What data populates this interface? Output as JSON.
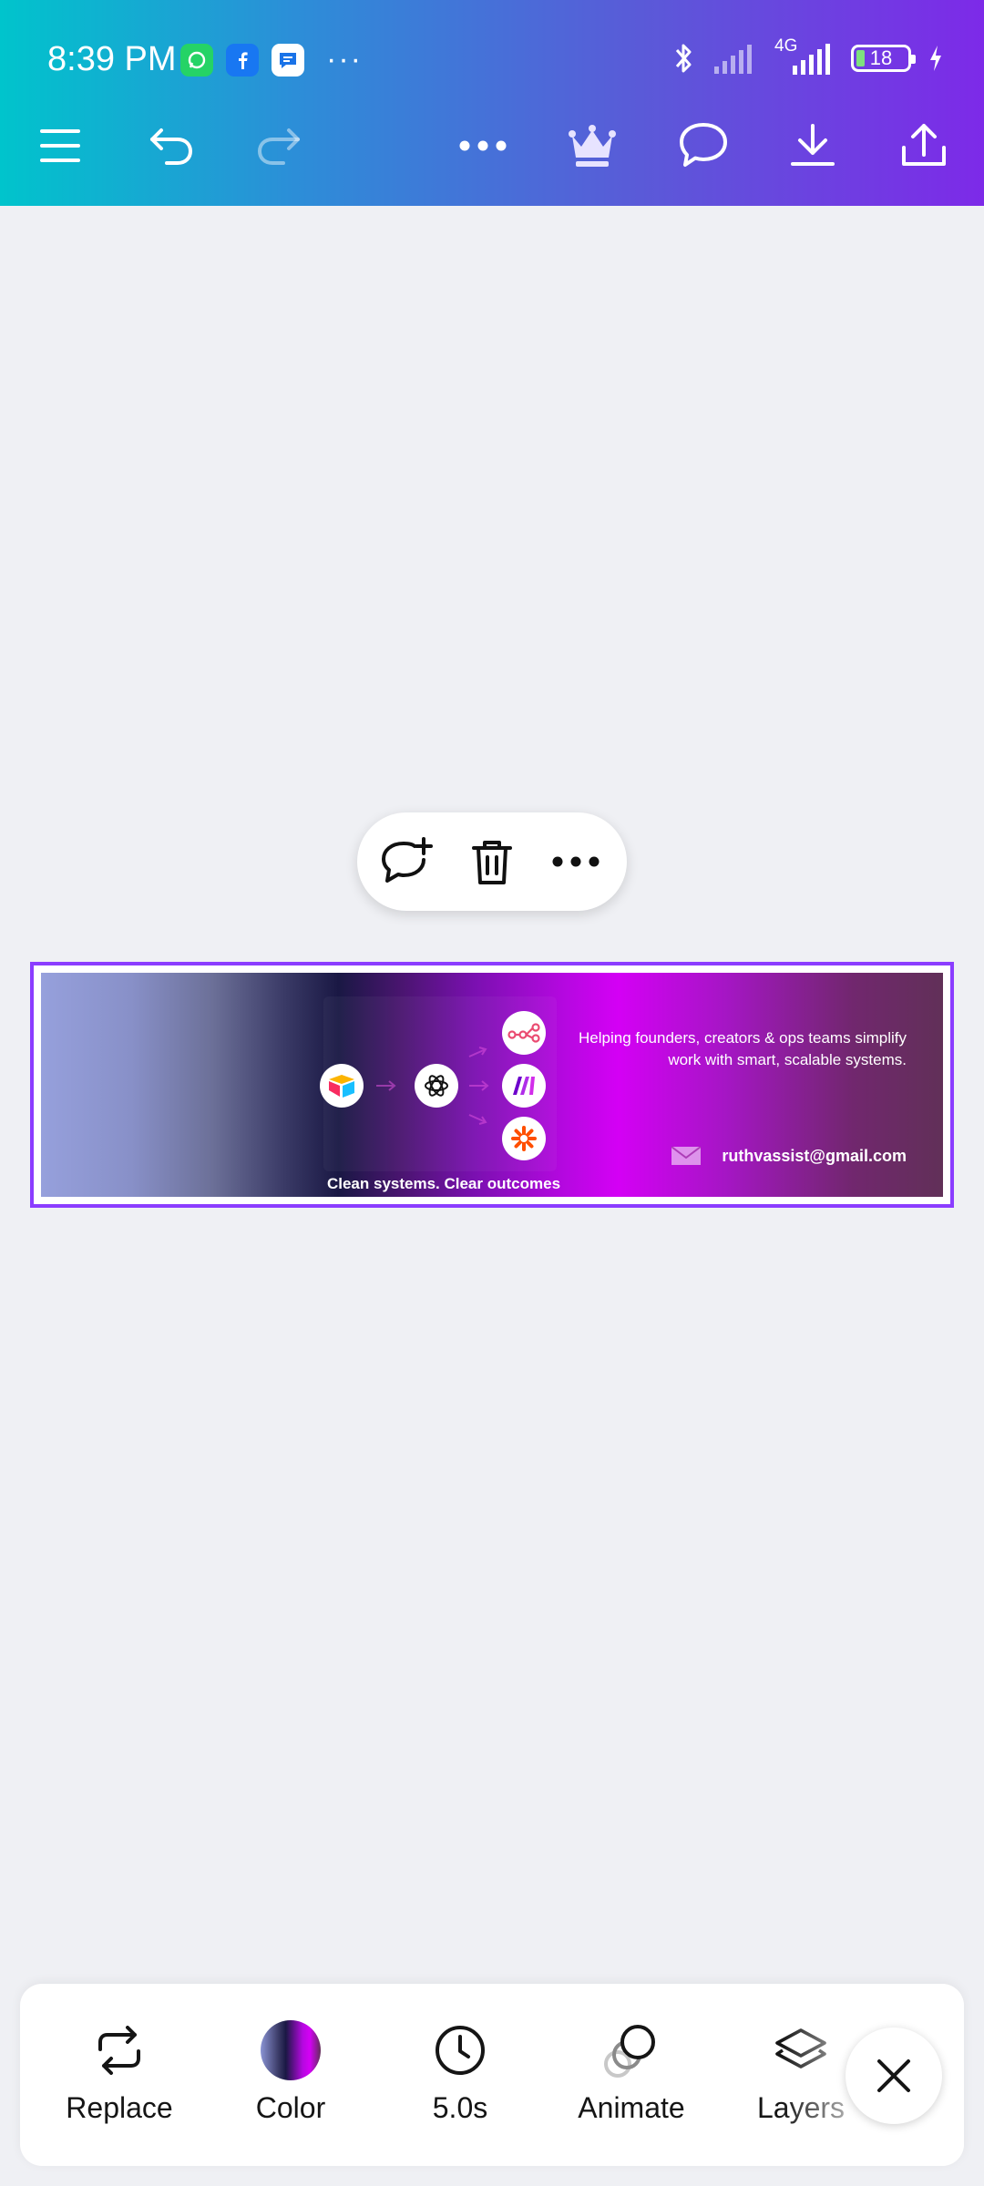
{
  "status_bar": {
    "time": "8:39 PM",
    "network": "4G",
    "battery": "18",
    "notification_icons": [
      "whatsapp-icon",
      "facebook-icon",
      "messages-icon"
    ],
    "more": "···"
  },
  "toolbar": {
    "icons": [
      "menu-icon",
      "undo-icon",
      "redo-icon",
      "more-options-icon",
      "premium-crown-icon",
      "comment-icon",
      "download-icon",
      "share-icon"
    ]
  },
  "context_menu": {
    "icons": [
      "add-comment-icon",
      "delete-icon",
      "more-options-icon"
    ]
  },
  "design": {
    "tagline": "Clean systems. Clear outcomes",
    "headline": "Helping founders, creators & ops teams simplify work with smart, scalable systems.",
    "email": "ruthvassist@gmail.com",
    "app_icons": [
      "airtable-icon",
      "openai-icon",
      "n8n-icon",
      "make-icon",
      "zapier-icon"
    ],
    "colors": {
      "selection": "#8b3dff",
      "gradient_left": "#96a0dc",
      "gradient_mid_dark": "#1a1844",
      "gradient_magenta": "#d400f5",
      "gradient_right": "#613058"
    }
  },
  "bottom_tools": [
    {
      "label": "Replace",
      "icon": "replace-icon"
    },
    {
      "label": "Color",
      "icon": "color-swatch-icon"
    },
    {
      "label": "5.0s",
      "icon": "clock-icon"
    },
    {
      "label": "Animate",
      "icon": "animate-icon"
    },
    {
      "label": "Layers",
      "icon": "layers-icon"
    }
  ],
  "brand_colors": {
    "header_start": "#00c4cc",
    "header_end": "#7d2ae8",
    "canvas_bg": "#eff0f4"
  }
}
